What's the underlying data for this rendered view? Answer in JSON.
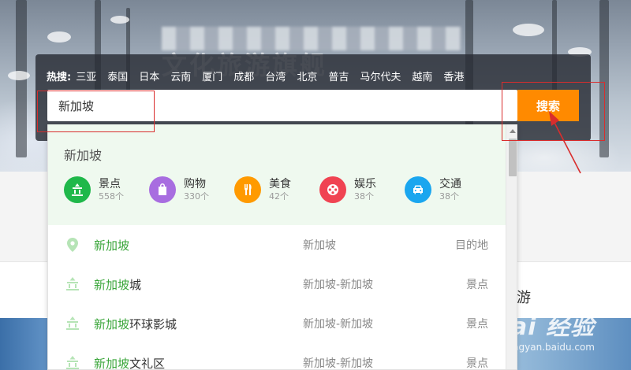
{
  "hero": {
    "ghost_title": "文化旅游旗舰"
  },
  "search": {
    "hot_label": "热搜:",
    "hot_items": [
      "三亚",
      "泰国",
      "日本",
      "云南",
      "厦门",
      "成都",
      "台湾",
      "北京",
      "普吉",
      "马尔代夫",
      "越南",
      "香港"
    ],
    "input_value": "新加坡",
    "button_label": "搜索"
  },
  "dropdown": {
    "city": "新加坡",
    "categories": [
      {
        "name": "景点",
        "count": "558个",
        "icon": "landmark-icon",
        "color": "#1fb84a"
      },
      {
        "name": "购物",
        "count": "330个",
        "icon": "shopping-bag-icon",
        "color": "#a86de0"
      },
      {
        "name": "美食",
        "count": "42个",
        "icon": "food-icon",
        "color": "#ff9a00"
      },
      {
        "name": "娱乐",
        "count": "38个",
        "icon": "film-reel-icon",
        "color": "#f04352"
      },
      {
        "name": "交通",
        "count": "38个",
        "icon": "car-icon",
        "color": "#1aa6ef"
      }
    ],
    "results": [
      {
        "highlight": "新加坡",
        "rest": "",
        "location": "新加坡",
        "type": "目的地",
        "icon": "location-pin-icon"
      },
      {
        "highlight": "新加坡",
        "rest": "城",
        "location": "新加坡-新加坡",
        "type": "景点",
        "icon": "landmark-icon"
      },
      {
        "highlight": "新加坡",
        "rest": "环球影城",
        "location": "新加坡-新加坡",
        "type": "景点",
        "icon": "landmark-icon"
      },
      {
        "highlight": "新加坡",
        "rest": "文礼区",
        "location": "新加坡-新加坡",
        "type": "景点",
        "icon": "landmark-icon"
      }
    ]
  },
  "page": {
    "partial_text": "游"
  },
  "watermark": {
    "main": "Bai 经验",
    "sub": "jingyan.baidu.com"
  },
  "colors": {
    "accent": "#ff8a00",
    "highlight": "#3aa63a",
    "annotation": "#d92d2d"
  }
}
